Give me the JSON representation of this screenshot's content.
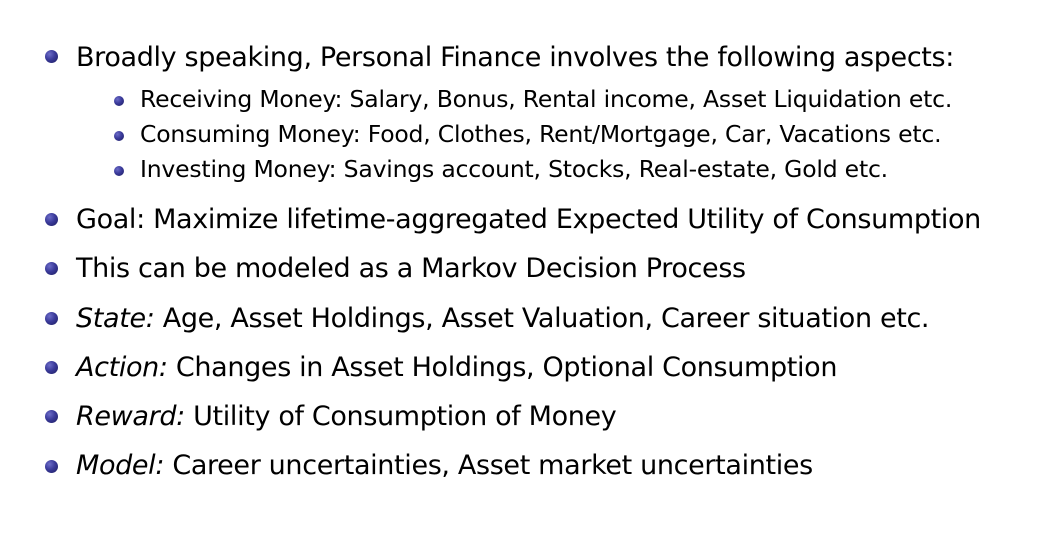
{
  "bullets": [
    {
      "label": "",
      "text": "Broadly speaking, Personal Finance involves the following aspects:",
      "sub": [
        "Receiving Money: Salary, Bonus, Rental income, Asset Liquidation etc.",
        "Consuming Money: Food, Clothes, Rent/Mortgage, Car, Vacations etc.",
        "Investing Money: Savings account, Stocks, Real-estate, Gold etc."
      ]
    },
    {
      "label": "",
      "text": "Goal: Maximize lifetime-aggregated Expected Utility of Consumption"
    },
    {
      "label": "",
      "text": "This can be modeled as a Markov Decision Process"
    },
    {
      "label": "State:",
      "text": "Age, Asset Holdings, Asset Valuation, Career situation etc."
    },
    {
      "label": "Action:",
      "text": "Changes in Asset Holdings, Optional Consumption"
    },
    {
      "label": "Reward:",
      "text": "Utility of Consumption of Money"
    },
    {
      "label": "Model:",
      "text": "Career uncertainties, Asset market uncertainties"
    }
  ],
  "colors": {
    "bullet": "#2e2e87",
    "text": "#000000",
    "background": "#ffffff"
  }
}
